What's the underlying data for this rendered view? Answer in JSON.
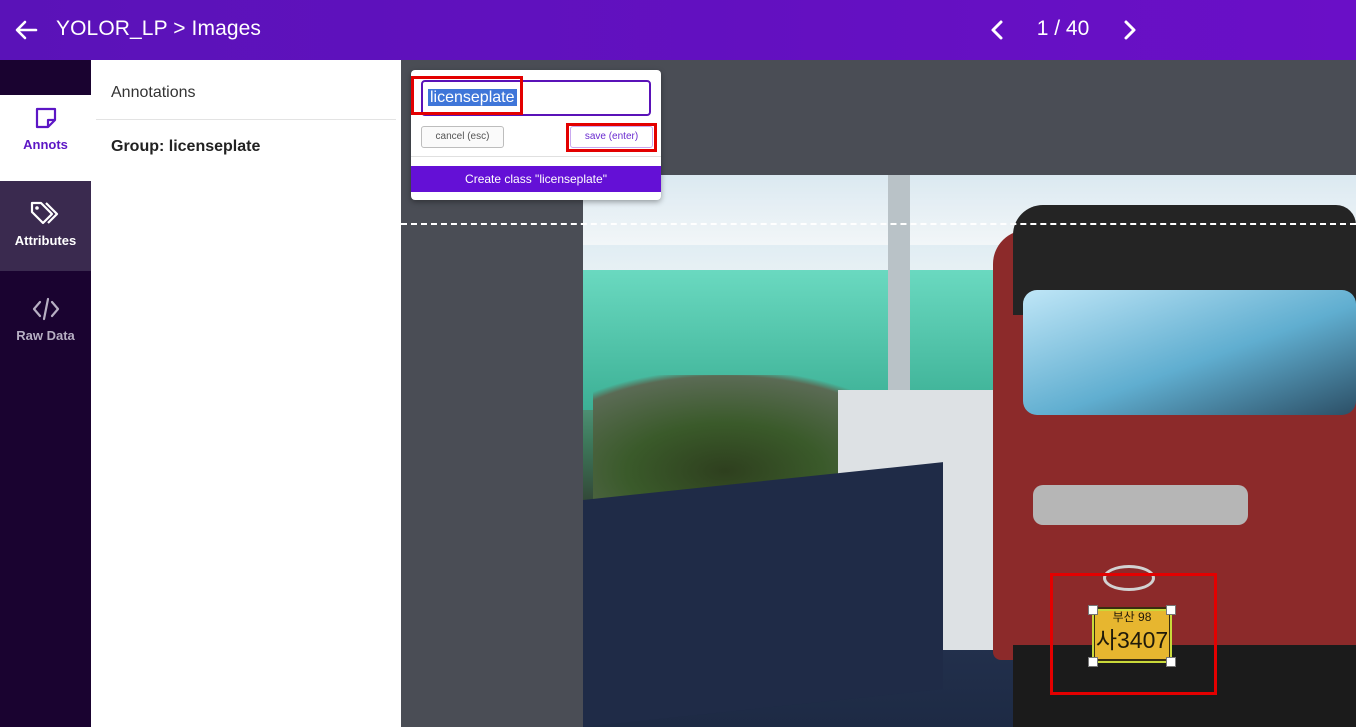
{
  "header": {
    "title": "YOLOR_LP > Images",
    "pager": "1 / 40",
    "icons": {
      "back": "arrow-left-icon",
      "prev": "chevron-left-icon",
      "next": "chevron-right-icon"
    }
  },
  "rail": {
    "items": [
      {
        "label": "Annots",
        "icon": "note-icon"
      },
      {
        "label": "Attributes",
        "icon": "tags-icon"
      },
      {
        "label": "Raw Data",
        "icon": "code-icon"
      }
    ]
  },
  "panel": {
    "heading": "Annotations",
    "group": "Group: licenseplate"
  },
  "popup": {
    "input_value": "licenseplate",
    "cancel_label": "cancel (esc)",
    "save_label": "save (enter)",
    "create_label": "Create class \"licenseplate\""
  },
  "image": {
    "plate_top": "부산 98",
    "plate_main": "사3407"
  },
  "colors": {
    "accent": "#6410d6",
    "header": "#5a12b8",
    "rail_bg": "#1a0330",
    "highlight": "#e30000",
    "bbox": "#c9d93a"
  }
}
